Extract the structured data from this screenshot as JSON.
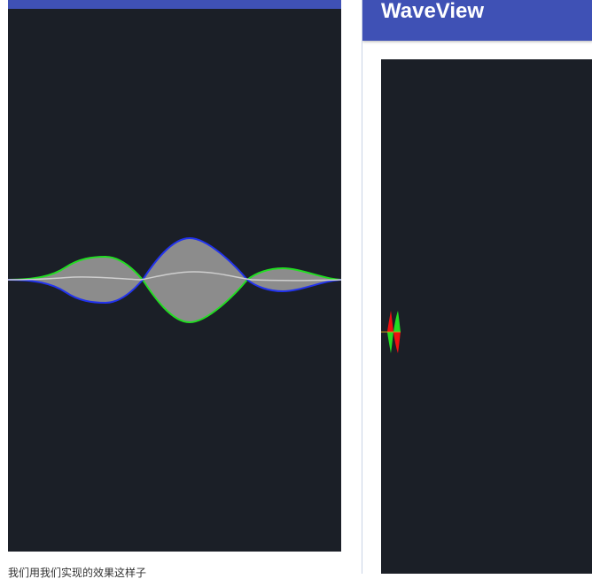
{
  "left_panel": {
    "caption": "我们用我们实现的效果这样子"
  },
  "right_panel": {
    "title": "WaveView"
  },
  "colors": {
    "appbar": "#3f51b5",
    "canvas_background": "#1b1f27",
    "wave_fill": "#8c8c8c",
    "wave_green": "#22dd22",
    "wave_blue": "#2233ee",
    "wave_center": "#cfcfcf",
    "marker_red": "#ee1111",
    "marker_green": "#22dd22"
  }
}
